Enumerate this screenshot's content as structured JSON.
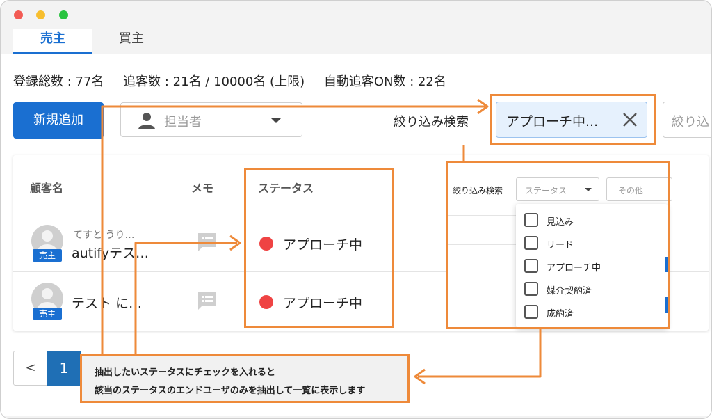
{
  "tabs": [
    {
      "label": "売主",
      "active": true
    },
    {
      "label": "買主",
      "active": false
    }
  ],
  "stats": {
    "registered": "登録総数 : 77名",
    "tracking": "追客数 : 21名 / 10000名 (上限)",
    "auto_on": "自動追客ON数 : 22名"
  },
  "toolbar": {
    "add_button": "新規追加",
    "assignee_placeholder": "担当者",
    "filter_label": "絞り込み検索",
    "filter_chip": "アプローチ中...",
    "filter_input_placeholder": "絞り込"
  },
  "table": {
    "headers": [
      "顧客名",
      "メモ",
      "ステータス"
    ],
    "rows": [
      {
        "kana": "てすと うり…",
        "name": "autifyテス…",
        "badge": "売主",
        "status": "アプローチ中"
      },
      {
        "kana": "",
        "name": "テスト に…",
        "badge": "売主",
        "status": "アプローチ中"
      }
    ]
  },
  "popup": {
    "filter_label": "絞り込み検索",
    "status_placeholder": "ステータス",
    "other_placeholder": "その他",
    "options": [
      "見込み",
      "リード",
      "アプローチ中",
      "媒介契約済",
      "成約済"
    ]
  },
  "pagination": {
    "prev": "<",
    "current": "1"
  },
  "callout": {
    "line1": "抽出したいステータスにチェックを入れると",
    "line2": "該当のステータスのエンドユーザのみを抽出して一覧に表示します"
  },
  "colors": {
    "accent": "#1a6fd1",
    "highlight": "#ee8a3a",
    "status_dot": "#ef4343",
    "chip_bg": "#e6f1fd"
  }
}
